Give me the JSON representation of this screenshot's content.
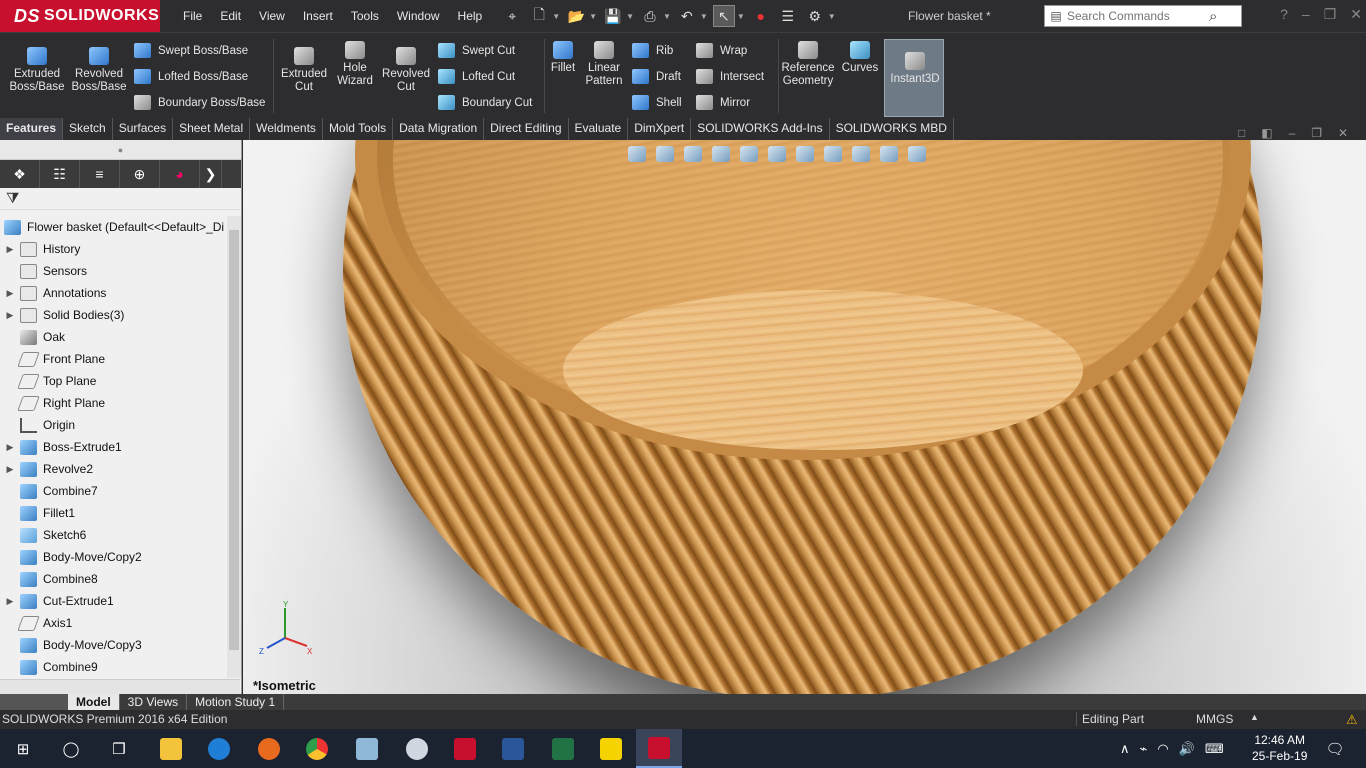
{
  "app": {
    "brand": "SOLIDWORKS",
    "doc_title": "Flower basket *"
  },
  "menu": [
    "File",
    "Edit",
    "View",
    "Insert",
    "Tools",
    "Window",
    "Help"
  ],
  "search": {
    "placeholder": "Search Commands"
  },
  "ribbon": {
    "extruded_boss": "Extruded Boss/Base",
    "revolved_boss": "Revolved Boss/Base",
    "swept_boss": "Swept Boss/Base",
    "lofted_boss": "Lofted Boss/Base",
    "boundary_boss": "Boundary Boss/Base",
    "extruded_cut": "Extruded Cut",
    "hole_wizard": "Hole Wizard",
    "revolved_cut": "Revolved Cut",
    "swept_cut": "Swept Cut",
    "lofted_cut": "Lofted Cut",
    "boundary_cut": "Boundary Cut",
    "fillet": "Fillet",
    "linear_pattern": "Linear Pattern",
    "rib": "Rib",
    "draft": "Draft",
    "shell": "Shell",
    "wrap": "Wrap",
    "intersect": "Intersect",
    "mirror": "Mirror",
    "reference_geometry": "Reference Geometry",
    "curves": "Curves",
    "instant3d": "Instant3D"
  },
  "command_tabs": [
    "Features",
    "Sketch",
    "Surfaces",
    "Sheet Metal",
    "Weldments",
    "Mold Tools",
    "Data Migration",
    "Direct Editing",
    "Evaluate",
    "DimXpert",
    "SOLIDWORKS Add-Ins",
    "SOLIDWORKS MBD"
  ],
  "tree": {
    "root": "Flower basket  (Default<<Default>_Di",
    "items": [
      {
        "label": "History",
        "icon": "history-icon",
        "expand": true,
        "kind": "folder"
      },
      {
        "label": "Sensors",
        "icon": "sensors-icon",
        "expand": false,
        "kind": "folder"
      },
      {
        "label": "Annotations",
        "icon": "annotations-icon",
        "expand": true,
        "kind": "folder"
      },
      {
        "label": "Solid Bodies(3)",
        "icon": "solid-bodies-icon",
        "expand": true,
        "kind": "folder"
      },
      {
        "label": "Oak",
        "icon": "material-icon",
        "expand": false,
        "kind": "oak"
      },
      {
        "label": "Front Plane",
        "icon": "plane-icon",
        "expand": false,
        "kind": "plane"
      },
      {
        "label": "Top Plane",
        "icon": "plane-icon",
        "expand": false,
        "kind": "plane"
      },
      {
        "label": "Right Plane",
        "icon": "plane-icon",
        "expand": false,
        "kind": "plane"
      },
      {
        "label": "Origin",
        "icon": "origin-icon",
        "expand": false,
        "kind": "origin"
      },
      {
        "label": "Boss-Extrude1",
        "icon": "extrude-icon",
        "expand": true,
        "kind": "feat"
      },
      {
        "label": "Revolve2",
        "icon": "revolve-icon",
        "expand": true,
        "kind": "feat"
      },
      {
        "label": "Combine7",
        "icon": "combine-icon",
        "expand": false,
        "kind": "feat"
      },
      {
        "label": "Fillet1",
        "icon": "fillet-icon",
        "expand": false,
        "kind": "feat"
      },
      {
        "label": "Sketch6",
        "icon": "sketch-icon",
        "expand": false,
        "kind": "sketch"
      },
      {
        "label": "Body-Move/Copy2",
        "icon": "move-copy-icon",
        "expand": false,
        "kind": "feat"
      },
      {
        "label": "Combine8",
        "icon": "combine-icon",
        "expand": false,
        "kind": "feat"
      },
      {
        "label": "Cut-Extrude1",
        "icon": "cut-extrude-icon",
        "expand": true,
        "kind": "feat"
      },
      {
        "label": "Axis1",
        "icon": "axis-icon",
        "expand": false,
        "kind": "plane"
      },
      {
        "label": "Body-Move/Copy3",
        "icon": "move-copy-icon",
        "expand": false,
        "kind": "feat"
      },
      {
        "label": "Combine9",
        "icon": "combine-icon",
        "expand": false,
        "kind": "feat"
      }
    ]
  },
  "viewport": {
    "view_name": "*Isometric",
    "triad": {
      "x": "X",
      "y": "Y",
      "z": "Z"
    }
  },
  "bottom_tabs": [
    "Model",
    "3D Views",
    "Motion Study 1"
  ],
  "status": {
    "edition": "SOLIDWORKS Premium 2016 x64 Edition",
    "mode": "Editing Part",
    "units": "MMGS"
  },
  "taskbar": {
    "time": "12:46 AM",
    "date": "25-Feb-19"
  }
}
